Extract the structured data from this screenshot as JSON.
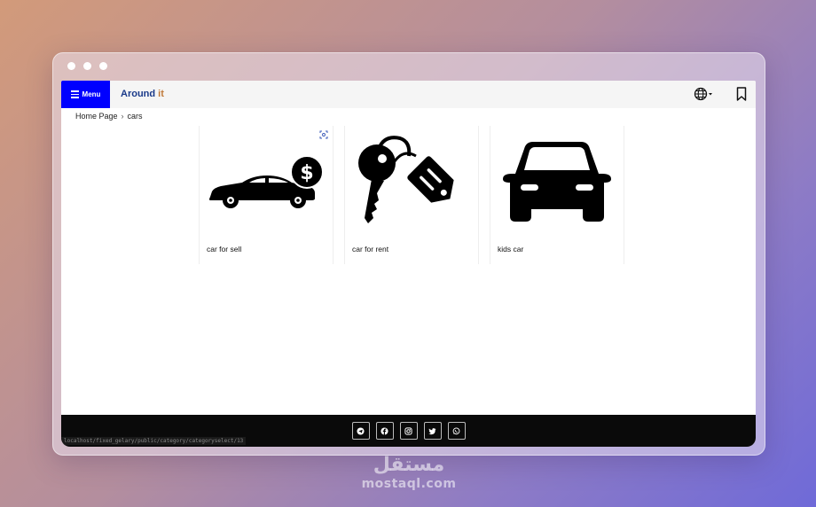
{
  "header": {
    "menu_label": "Menu",
    "brand_main": "Around",
    "brand_accent": "it",
    "globe_icon": "globe-icon",
    "bookmark_icon": "bookmark-icon"
  },
  "breadcrumb": {
    "home": "Home Page",
    "separator": "›",
    "current": "cars"
  },
  "cards": [
    {
      "title": "car for sell",
      "icon": "car-with-dollar-icon"
    },
    {
      "title": "car for rent",
      "icon": "key-with-tag-icon"
    },
    {
      "title": "kids car",
      "icon": "car-front-icon"
    }
  ],
  "footer": {
    "social": [
      "telegram-icon",
      "facebook-icon",
      "instagram-icon",
      "twitter-icon",
      "whatsapp-icon"
    ]
  },
  "status_url": "localhost/fixed_gelary/public/category/categoryselect/13",
  "watermark": {
    "arabic": "مستقل",
    "latin": "mostaql.com"
  },
  "colors": {
    "menu_bg": "#0000ff",
    "brand": "#1a3a8a",
    "footer_bg": "#0a0a0a"
  }
}
